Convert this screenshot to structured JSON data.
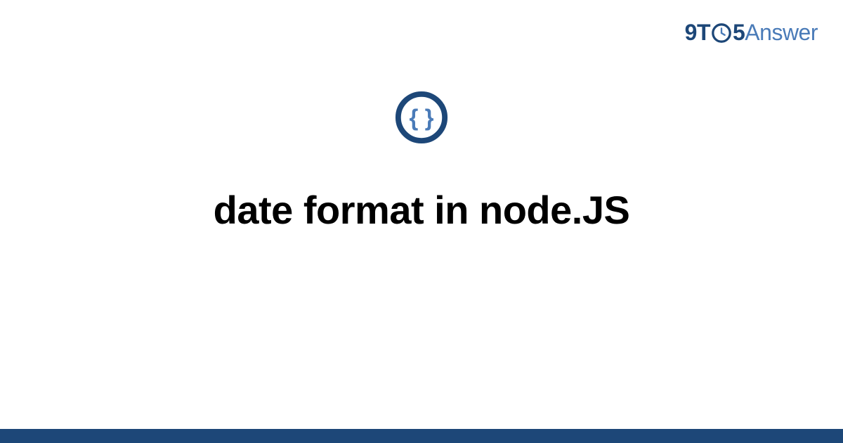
{
  "brand": {
    "part1": "9T",
    "part2": "5",
    "part3": "Answer"
  },
  "content": {
    "icon_name": "code-braces-icon",
    "title": "date format in node.JS"
  },
  "colors": {
    "brand_dark": "#1d4778",
    "brand_light": "#4a7bb8",
    "footer_bar": "#1d4778"
  }
}
